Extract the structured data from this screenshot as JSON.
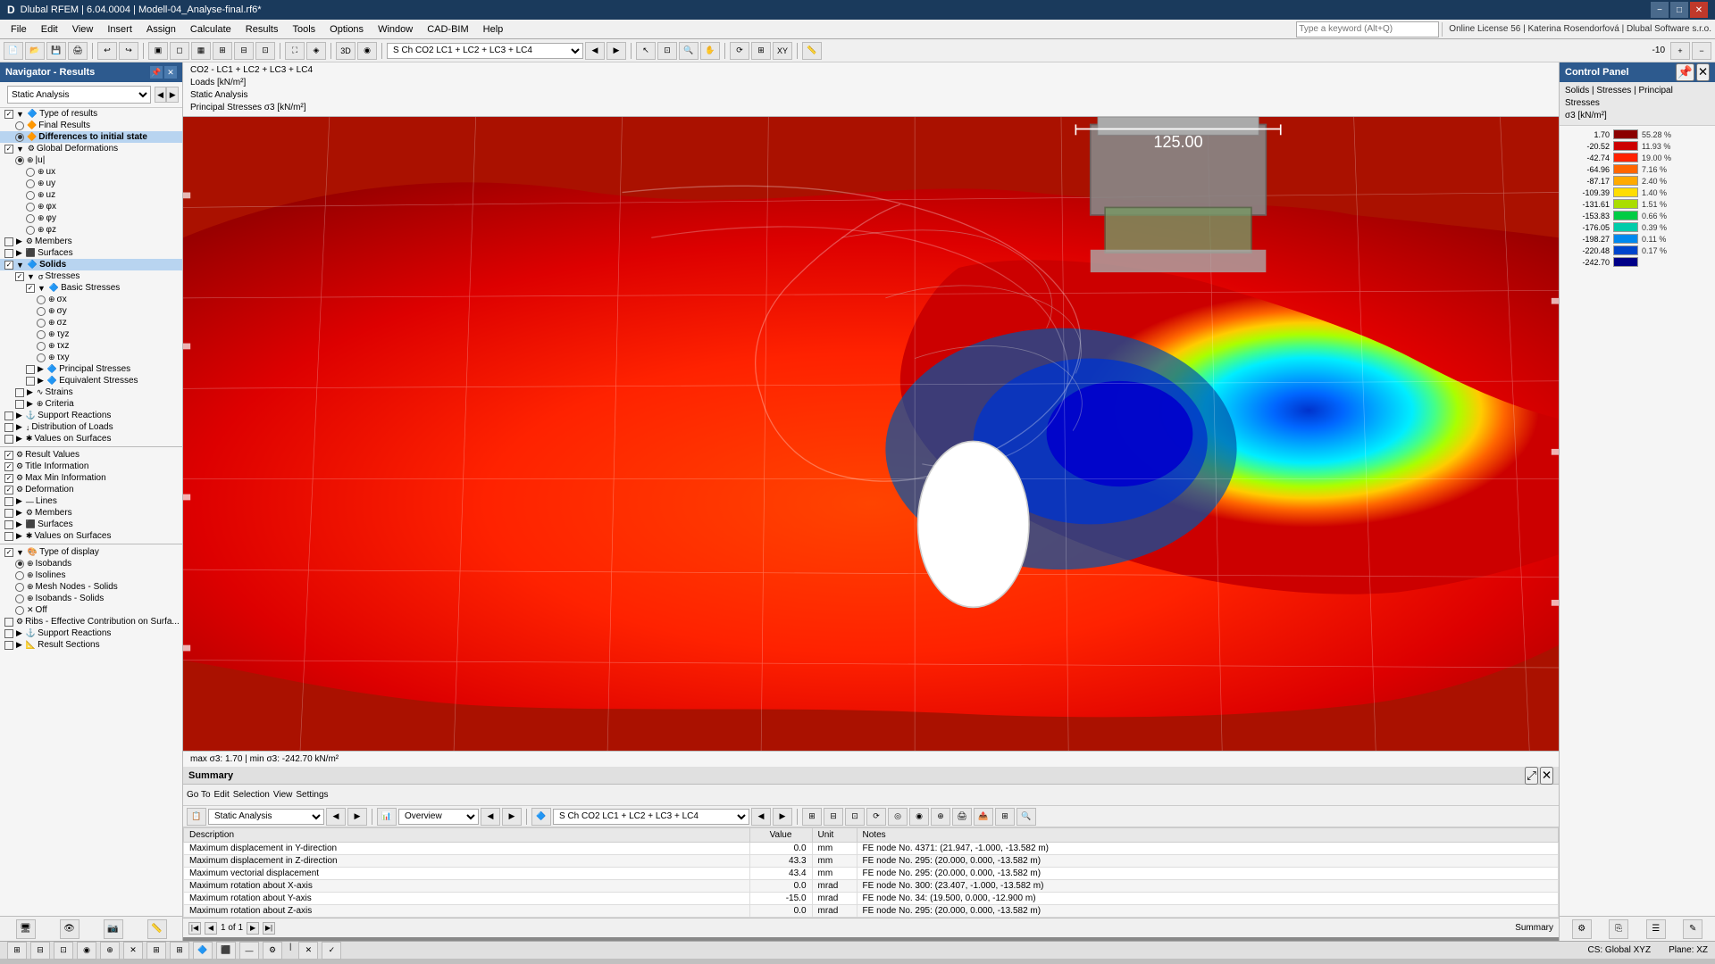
{
  "titlebar": {
    "title": "Dlubal RFEM | 6.04.0004 | Modell-04_Analyse-final.rf6*",
    "logo": "D",
    "min_label": "−",
    "max_label": "□",
    "close_label": "✕"
  },
  "menubar": {
    "items": [
      "File",
      "Edit",
      "View",
      "Insert",
      "Assign",
      "Calculate",
      "Results",
      "Tools",
      "Options",
      "Window",
      "CAD-BIM",
      "Help"
    ]
  },
  "search_placeholder": "Type a keyword (Alt+Q)",
  "license_info": "Online License 56 | Katerina Rosendorfová | Dlubal Software s.r.o.",
  "navigator": {
    "title": "Navigator - Results",
    "dropdown": "Static Analysis",
    "tree": [
      {
        "level": 0,
        "type": "expand",
        "label": "Type of results",
        "checked": true
      },
      {
        "level": 1,
        "type": "radio",
        "label": "Final Results",
        "selected": false
      },
      {
        "level": 1,
        "type": "radio",
        "label": "Differences to initial state",
        "selected": true,
        "bold": true
      },
      {
        "level": 0,
        "type": "expand",
        "label": "Global Deformations",
        "checked": true
      },
      {
        "level": 1,
        "type": "radio",
        "label": "|u|",
        "selected": true
      },
      {
        "level": 2,
        "type": "radio",
        "label": "ux",
        "selected": false
      },
      {
        "level": 2,
        "type": "radio",
        "label": "uy",
        "selected": false
      },
      {
        "level": 2,
        "type": "radio",
        "label": "uz",
        "selected": false
      },
      {
        "level": 2,
        "type": "radio",
        "label": "φx",
        "selected": false
      },
      {
        "level": 2,
        "type": "radio",
        "label": "φy",
        "selected": false
      },
      {
        "level": 2,
        "type": "radio",
        "label": "φz",
        "selected": false
      },
      {
        "level": 0,
        "type": "expand",
        "label": "Members",
        "checked": false
      },
      {
        "level": 0,
        "type": "expand",
        "label": "Surfaces",
        "checked": false
      },
      {
        "level": 0,
        "type": "expand",
        "label": "Solids",
        "checked": true,
        "active": true
      },
      {
        "level": 1,
        "type": "expand",
        "label": "Stresses",
        "checked": true
      },
      {
        "level": 2,
        "type": "expand",
        "label": "Basic Stresses",
        "checked": true
      },
      {
        "level": 3,
        "type": "radio",
        "label": "σx",
        "selected": false
      },
      {
        "level": 3,
        "type": "radio",
        "label": "σy",
        "selected": false
      },
      {
        "level": 3,
        "type": "radio",
        "label": "σz",
        "selected": false
      },
      {
        "level": 3,
        "type": "radio",
        "label": "τyz",
        "selected": false
      },
      {
        "level": 3,
        "type": "radio",
        "label": "τxz",
        "selected": false
      },
      {
        "level": 3,
        "type": "radio",
        "label": "τxy",
        "selected": false
      },
      {
        "level": 2,
        "type": "expand",
        "label": "Principal Stresses",
        "checked": false
      },
      {
        "level": 2,
        "type": "expand",
        "label": "Equivalent Stresses",
        "checked": false
      },
      {
        "level": 1,
        "type": "expand",
        "label": "Strains",
        "checked": false
      },
      {
        "level": 1,
        "type": "expand",
        "label": "Criteria",
        "checked": false
      },
      {
        "level": 0,
        "type": "expand",
        "label": "Support Reactions",
        "checked": false
      },
      {
        "level": 0,
        "type": "expand",
        "label": "Distribution of Loads",
        "checked": false
      },
      {
        "level": 0,
        "type": "expand",
        "label": "Values on Surfaces",
        "checked": false
      },
      {
        "level": 0,
        "type": "separator"
      },
      {
        "level": 0,
        "type": "expand",
        "label": "Result Values",
        "checked": true
      },
      {
        "level": 0,
        "type": "check",
        "label": "Title Information",
        "checked": true
      },
      {
        "level": 0,
        "type": "check",
        "label": "Max Min Information",
        "checked": true
      },
      {
        "level": 0,
        "type": "check",
        "label": "Deformation",
        "checked": true
      },
      {
        "level": 0,
        "type": "expand",
        "label": "Lines",
        "checked": false
      },
      {
        "level": 0,
        "type": "expand",
        "label": "Members",
        "checked": false
      },
      {
        "level": 0,
        "type": "expand",
        "label": "Surfaces",
        "checked": false
      },
      {
        "level": 0,
        "type": "expand",
        "label": "Values on Surfaces",
        "checked": false
      },
      {
        "level": 0,
        "type": "separator"
      },
      {
        "level": 0,
        "type": "expand",
        "label": "Type of display",
        "checked": true
      },
      {
        "level": 1,
        "type": "radio",
        "label": "Isobands",
        "selected": true
      },
      {
        "level": 1,
        "type": "radio",
        "label": "Isolines",
        "selected": false
      },
      {
        "level": 1,
        "type": "radio",
        "label": "Mesh Nodes - Solids",
        "selected": false
      },
      {
        "level": 1,
        "type": "radio",
        "label": "Isobands - Solids",
        "selected": false
      },
      {
        "level": 1,
        "type": "radio",
        "label": "Off",
        "selected": false
      },
      {
        "level": 0,
        "type": "check",
        "label": "Ribs - Effective Contribution on Surfa...",
        "checked": false
      },
      {
        "level": 0,
        "type": "expand",
        "label": "Support Reactions",
        "checked": false
      },
      {
        "level": 0,
        "type": "expand",
        "label": "Result Sections",
        "checked": false
      }
    ]
  },
  "info_bar": {
    "line1": "CO2 - LC1 + LC2 + LC3 + LC4",
    "line2": "Loads [kN/m²]",
    "line3": "Static Analysis",
    "line4": "Principal Stresses σ3 [kN/m²]"
  },
  "viewport": {
    "dimension_label": "125.00",
    "status_text": "max σ3: 1.70 | min σ3: -242.70 kN/m²"
  },
  "color_legend": {
    "title": "Solids | Stresses | Principal Stresses",
    "subtitle": "σ3 [kN/m²]",
    "entries": [
      {
        "value": "1.70",
        "color": "#8B0000",
        "pct": "55.28 %"
      },
      {
        "value": "-20.52",
        "color": "#cc0000",
        "pct": "11.93 %"
      },
      {
        "value": "-42.74",
        "color": "#ff2200",
        "pct": "19.00 %"
      },
      {
        "value": "-64.96",
        "color": "#ff6600",
        "pct": "7.16 %"
      },
      {
        "value": "-87.17",
        "color": "#ffaa00",
        "pct": "2.40 %"
      },
      {
        "value": "-109.39",
        "color": "#ffdd00",
        "pct": "1.40 %"
      },
      {
        "value": "-131.61",
        "color": "#aadd00",
        "pct": "1.51 %"
      },
      {
        "value": "-153.83",
        "color": "#00cc44",
        "pct": "0.66 %"
      },
      {
        "value": "-176.05",
        "color": "#00ccaa",
        "pct": "0.39 %"
      },
      {
        "value": "-198.27",
        "color": "#0088ee",
        "pct": "0.11 %"
      },
      {
        "value": "-220.48",
        "color": "#0044cc",
        "pct": "0.17 %"
      },
      {
        "value": "-242.70",
        "color": "#000088",
        "pct": ""
      }
    ]
  },
  "summary": {
    "panel_title": "Summary",
    "menu_items": [
      "Go To",
      "Edit",
      "Selection",
      "View",
      "Settings"
    ],
    "dropdown_analysis": "Static Analysis",
    "dropdown_overview": "Overview",
    "combo_case": "S Ch  CO2    LC1 + LC2 + LC3 + LC4",
    "columns": [
      "Description",
      "Value",
      "Unit",
      "Notes"
    ],
    "rows": [
      {
        "description": "Maximum displacement in Y-direction",
        "value": "0.0",
        "unit": "mm",
        "notes": "FE node No. 4371: (21.947, -1.000, -13.582 m)"
      },
      {
        "description": "Maximum displacement in Z-direction",
        "value": "43.3",
        "unit": "mm",
        "notes": "FE node No. 295: (20.000, 0.000, -13.582 m)"
      },
      {
        "description": "Maximum vectorial displacement",
        "value": "43.4",
        "unit": "mm",
        "notes": "FE node No. 295: (20.000, 0.000, -13.582 m)"
      },
      {
        "description": "Maximum rotation about X-axis",
        "value": "0.0",
        "unit": "mrad",
        "notes": "FE node No. 300: (23.407, -1.000, -13.582 m)"
      },
      {
        "description": "Maximum rotation about Y-axis",
        "value": "-15.0",
        "unit": "mrad",
        "notes": "FE node No. 34: (19.500, 0.000, -12.900 m)"
      },
      {
        "description": "Maximum rotation about Z-axis",
        "value": "0.0",
        "unit": "mrad",
        "notes": "FE node No. 295: (20.000, 0.000, -13.582 m)"
      }
    ],
    "footer_page": "1 of 1",
    "footer_tab": "Summary"
  },
  "toolbar_combo": "S Ch  CO2    LC1 + LC2 + LC3 + LC4",
  "status_bar": {
    "left": "CS: Global XYZ",
    "right": "Plane: XZ"
  }
}
